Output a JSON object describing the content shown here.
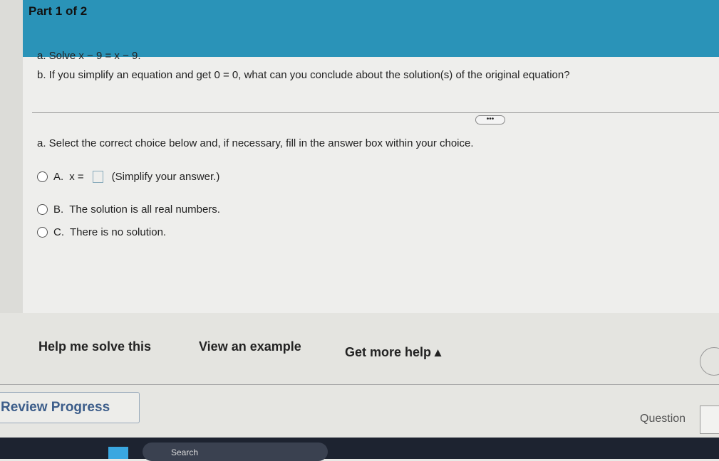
{
  "header": {
    "part": "Part 1 of 2"
  },
  "question": {
    "a": "a. Solve x − 9 = x − 9.",
    "b": "b. If you simplify an equation and get 0 = 0, what can you conclude about the solution(s) of the original equation?"
  },
  "more_label": "•••",
  "instruction": "a. Select the correct choice below and, if necessary, fill in the answer box within your choice.",
  "options": [
    {
      "letter": "A.",
      "prefix": "x =",
      "text": "(Simplify your answer.)"
    },
    {
      "letter": "B.",
      "text": "The solution is all real numbers."
    },
    {
      "letter": "C.",
      "text": "There is no solution."
    }
  ],
  "help": {
    "solve": "Help me solve this",
    "example": "View an example",
    "more": "Get more help ▴"
  },
  "footer": {
    "review": "Review Progress",
    "question": "Question"
  },
  "taskbar": {
    "search": "Search"
  },
  "colors": {
    "header": "#2a93b8",
    "review_text": "#3c5d8a"
  }
}
